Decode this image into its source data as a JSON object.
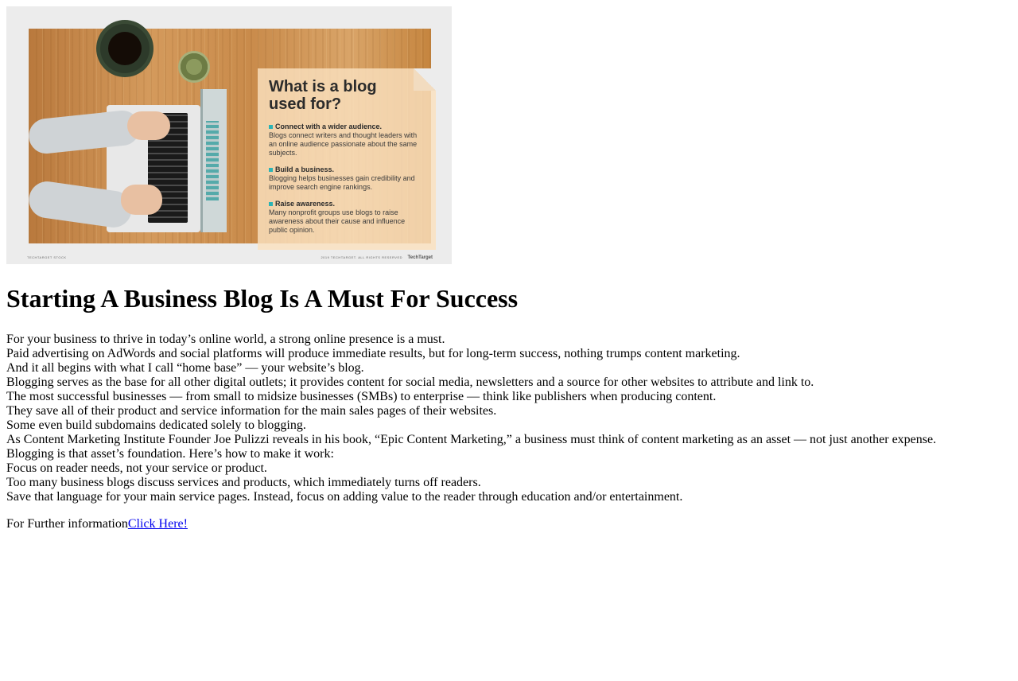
{
  "hero": {
    "card_title": "What is a blog used for?",
    "points": [
      {
        "title": "Connect with a wider audience.",
        "text": "Blogs connect writers and thought leaders with an online audience passionate about the same subjects."
      },
      {
        "title": "Build a business.",
        "text": "Blogging helps businesses gain credibility and improve search engine rankings."
      },
      {
        "title": "Raise awareness.",
        "text": "Many nonprofit groups use blogs to raise awareness about their cause and influence public opinion."
      }
    ],
    "credit_left": "TECHTARGET STOCK",
    "credit_right": "2019 TECHTARGET. ALL RIGHTS RESERVED",
    "brand": "TechTarget",
    "accent_color": "#2bb3b5"
  },
  "article": {
    "title": "Starting A Business Blog Is A Must For Success",
    "lines": [
      "For your business to thrive in today’s online world, a strong online presence is a must.",
      "Paid advertising on AdWords and social platforms will produce immediate results, but for long-term success, nothing trumps content marketing.",
      "And it all begins with what I call “home base” — your website’s blog.",
      "Blogging serves as the base for all other digital outlets; it provides content for social media, newsletters and a source for other websites to attribute and link to.",
      "The most successful businesses — from small to midsize businesses (SMBs) to enterprise — think like publishers when producing content.",
      "They save all of their product and service information for the main sales pages of their websites.",
      "Some even build subdomains dedicated solely to blogging.",
      "As Content Marketing Institute Founder Joe Pulizzi reveals in his book, “Epic Content Marketing,” a business must think of content marketing as an asset — not just another expense.",
      "Blogging is that asset’s foundation. Here’s how to make it work:",
      "Focus on reader needs, not your service or product.",
      "Too many business blogs discuss services and products, which immediately turns off readers.",
      "Save that language for your main service pages. Instead, focus on adding value to the reader through education and/or entertainment."
    ],
    "further_label": "For Further information",
    "link_text": "Click Here!",
    "link_color": "#0000ee"
  }
}
